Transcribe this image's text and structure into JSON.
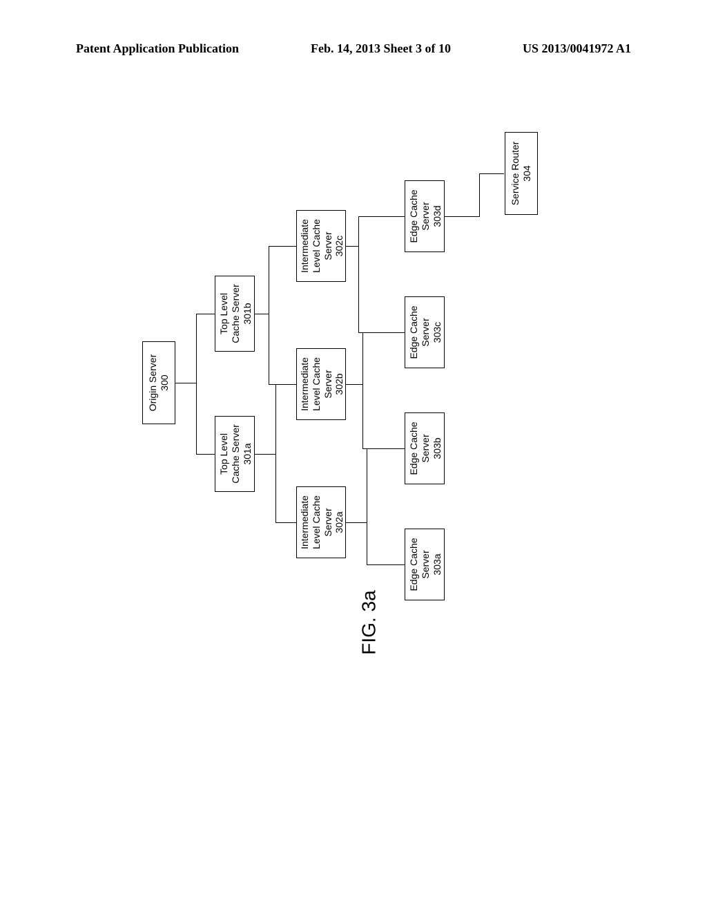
{
  "header": {
    "left": "Patent Application Publication",
    "center": "Feb. 14, 2013  Sheet 3 of 10",
    "right": "US 2013/0041972 A1"
  },
  "origin": {
    "line1": "Origin Server",
    "line2": "300"
  },
  "top_a": {
    "line1": "Top Level",
    "line2": "Cache Server",
    "line3": "301a"
  },
  "top_b": {
    "line1": "Top Level",
    "line2": "Cache Server",
    "line3": "301b"
  },
  "mid_a": {
    "line1": "Intermediate",
    "line2": "Level Cache",
    "line3": "Server",
    "line4": "302a"
  },
  "mid_b": {
    "line1": "Intermediate",
    "line2": "Level Cache",
    "line3": "Server",
    "line4": "302b"
  },
  "mid_c": {
    "line1": "Intermediate",
    "line2": "Level Cache",
    "line3": "Server",
    "line4": "302c"
  },
  "edge_a": {
    "line1": "Edge Cache",
    "line2": "Server",
    "line3": "303a"
  },
  "edge_b": {
    "line1": "Edge Cache",
    "line2": "Server",
    "line3": "303b"
  },
  "edge_c": {
    "line1": "Edge Cache",
    "line2": "Server",
    "line3": "303c"
  },
  "edge_d": {
    "line1": "Edge Cache",
    "line2": "Server",
    "line3": "303d"
  },
  "service_router": {
    "line1": "Service Router",
    "line2": "304"
  },
  "figure_label": "FIG. 3a"
}
